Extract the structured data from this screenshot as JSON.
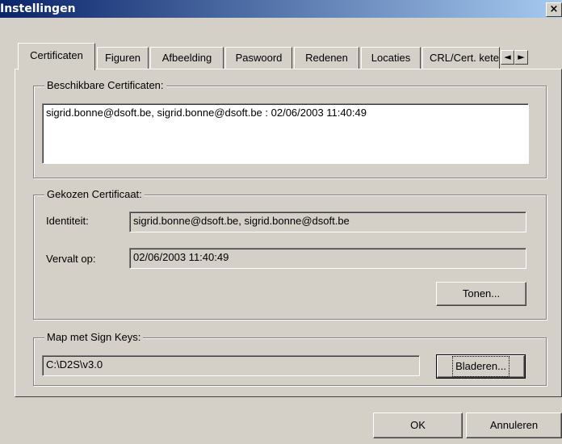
{
  "window": {
    "title": "Instellingen",
    "close_glyph": "×"
  },
  "tabs": [
    {
      "label": "Certificaten",
      "active": true
    },
    {
      "label": "Figuren",
      "active": false
    },
    {
      "label": "Afbeelding",
      "active": false
    },
    {
      "label": "Paswoord",
      "active": false
    },
    {
      "label": "Redenen",
      "active": false
    },
    {
      "label": "Locaties",
      "active": false
    },
    {
      "label": "CRL/Cert. keten",
      "active": false
    }
  ],
  "tab_scroll": {
    "left_glyph": "◄",
    "right_glyph": "►"
  },
  "available_certs": {
    "legend": "Beschikbare Certificaten:",
    "items": [
      "sigrid.bonne@dsoft.be, sigrid.bonne@dsoft.be : 02/06/2003   11:40:49"
    ]
  },
  "chosen_cert": {
    "legend": "Gekozen Certificaat:",
    "identity_label": "Identiteit:",
    "identity_value": "sigrid.bonne@dsoft.be, sigrid.bonne@dsoft.be",
    "expires_label": "Vervalt op:",
    "expires_value": "02/06/2003   11:40:49",
    "show_button": "Tonen..."
  },
  "sign_keys": {
    "legend": "Map met Sign Keys:",
    "path": "C:\\D2S\\v3.0",
    "browse_button": "Bladeren..."
  },
  "footer": {
    "ok_button": "OK",
    "cancel_button": "Annuleren"
  },
  "colors": {
    "face": "#d4d0c8",
    "title_start": "#0a246a",
    "title_end": "#a6caf0"
  }
}
